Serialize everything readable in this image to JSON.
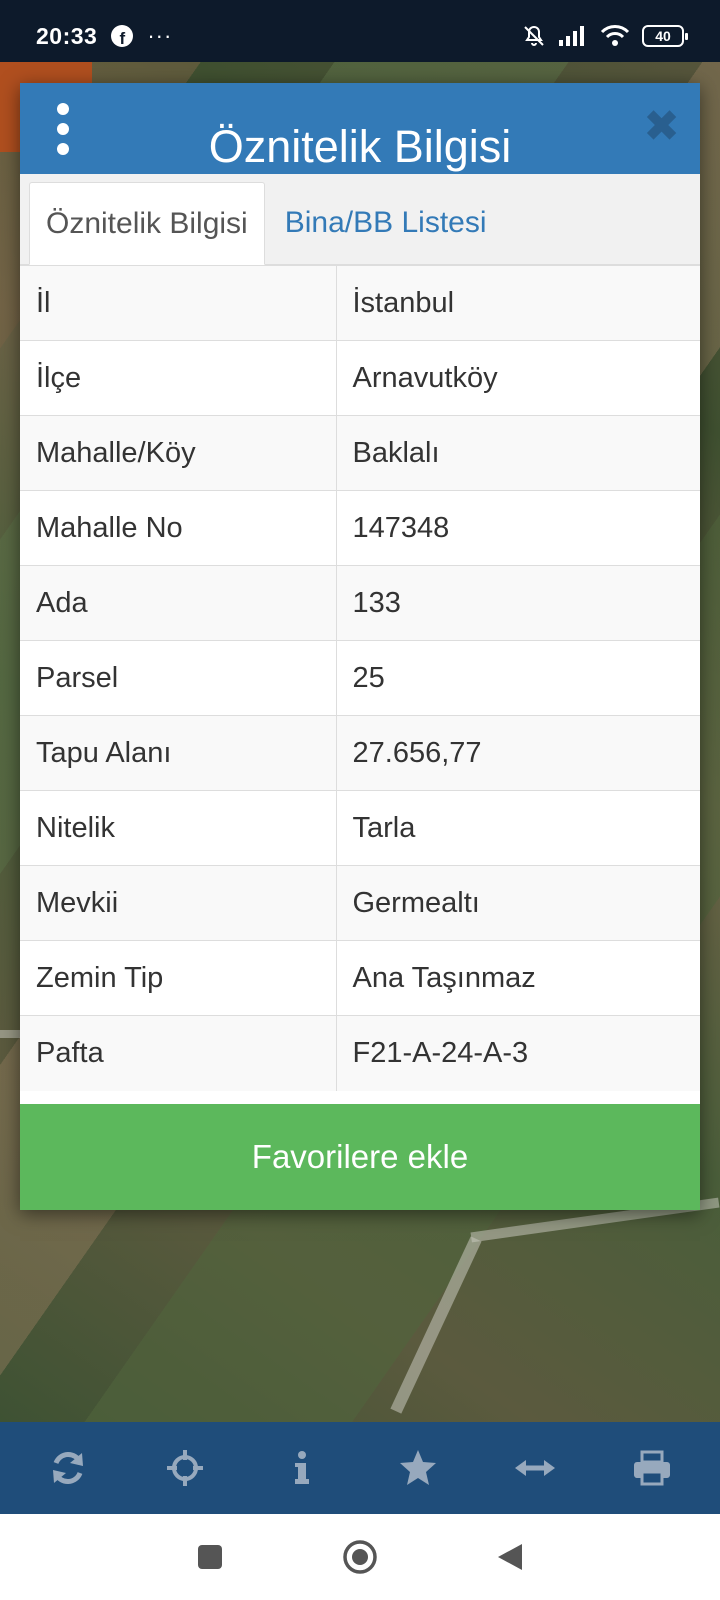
{
  "status_bar": {
    "time": "20:33",
    "more_glyph": "···",
    "battery": "40",
    "icons": [
      "facebook-icon",
      "more-icon",
      "mute-icon",
      "signal-icon",
      "wifi-icon",
      "battery-icon"
    ]
  },
  "modal": {
    "title": "Öznitelik Bilgisi",
    "close_glyph": "✖",
    "tabs": [
      {
        "label": "Öznitelik Bilgisi",
        "active": true
      },
      {
        "label": "Bina/BB Listesi",
        "active": false
      }
    ],
    "rows": [
      {
        "key": "İl",
        "value": "İstanbul"
      },
      {
        "key": "İlçe",
        "value": "Arnavutköy"
      },
      {
        "key": "Mahalle/Köy",
        "value": "Baklalı"
      },
      {
        "key": "Mahalle No",
        "value": "147348"
      },
      {
        "key": "Ada",
        "value": "133"
      },
      {
        "key": "Parsel",
        "value": "25"
      },
      {
        "key": "Tapu Alanı",
        "value": "27.656,77"
      },
      {
        "key": "Nitelik",
        "value": "Tarla"
      },
      {
        "key": "Mevkii",
        "value": "Germealtı"
      },
      {
        "key": "Zemin Tip",
        "value": "Ana Taşınmaz"
      },
      {
        "key": "Pafta",
        "value": "F21-A-24-A-3"
      }
    ],
    "favorite_button": "Favorilere ekle"
  },
  "toolbar": {
    "icons": [
      "refresh-icon",
      "crosshair-icon",
      "info-icon",
      "star-icon",
      "measure-icon",
      "print-icon"
    ]
  },
  "colors": {
    "header": "#337ab7",
    "favorite_button": "#5cb85c",
    "toolbar": "#1f4d7a",
    "status_bar": "#0d1a2b"
  }
}
